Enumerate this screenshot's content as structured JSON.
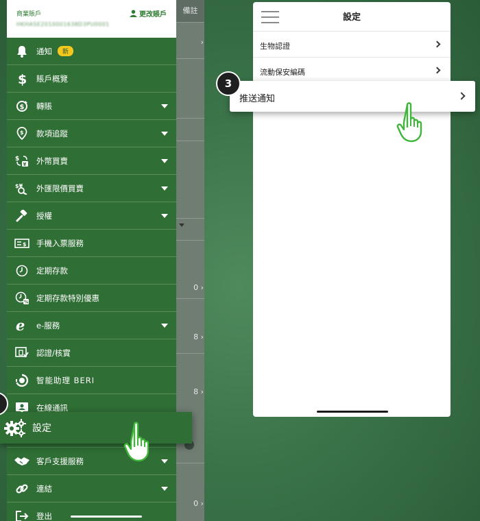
{
  "left": {
    "bg_header": "備註",
    "bg_row_values": [
      "0",
      "8",
      "8",
      "0"
    ],
    "account_type": "商業賬戶",
    "change_account": "更改賬戶",
    "account_number": "HKHASE2010001638D3PU0001",
    "menu": [
      {
        "label": "通知",
        "badge": "新",
        "icon": "bell-icon",
        "caret": false
      },
      {
        "label": "賬戶概覽",
        "icon": "dollar-icon",
        "caret": false
      },
      {
        "label": "轉賬",
        "icon": "transfer-icon",
        "caret": true
      },
      {
        "label": "款項追蹤",
        "icon": "tracking-icon",
        "caret": true
      },
      {
        "label": "外幣買賣",
        "icon": "currency-exchange-icon",
        "caret": true
      },
      {
        "label": "外匯限價買賣",
        "icon": "limit-order-icon",
        "caret": true
      },
      {
        "label": "授權",
        "icon": "gavel-icon",
        "caret": true
      },
      {
        "label": "手機入票服務",
        "icon": "cheque-icon",
        "caret": false
      },
      {
        "label": "定期存款",
        "icon": "clock-icon",
        "caret": false
      },
      {
        "label": "定期存款特別優惠",
        "icon": "clock-offer-icon",
        "caret": false
      },
      {
        "label": "e-服務",
        "icon": "e-icon",
        "caret": true
      },
      {
        "label": "認證/核實",
        "icon": "verify-icon",
        "caret": false
      },
      {
        "label": "智能助理 BERI",
        "icon": "assistant-icon",
        "caret": false
      },
      {
        "label": "在線通訊",
        "icon": "contact-icon",
        "caret": false
      },
      {
        "label": "",
        "icon": "",
        "caret": false
      },
      {
        "label": "客戶支援服務",
        "icon": "handshake-icon",
        "caret": true
      },
      {
        "label": "連結",
        "icon": "link-icon",
        "caret": true
      },
      {
        "label": "登出",
        "icon": "logout-icon",
        "caret": false
      }
    ],
    "settings_highlight": "設定"
  },
  "right": {
    "title": "設定",
    "rows": [
      "生物認證",
      "流動保安編碼"
    ],
    "push_notification": "推送通知",
    "step_number": "3"
  },
  "colors": {
    "drawer_green": "#2f6e35",
    "badge_yellow": "#f4c81d",
    "hand_green": "#3fb53a"
  }
}
